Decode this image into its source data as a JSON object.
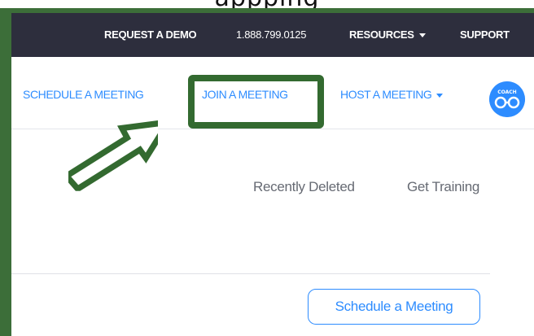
{
  "caption": {
    "text": "appping"
  },
  "topbar": {
    "request_demo": "REQUEST A DEMO",
    "phone": "1.888.799.0125",
    "resources": "RESOURCES",
    "support": "SUPPORT"
  },
  "nav": {
    "schedule": "SCHEDULE A MEETING",
    "join": "JOIN A MEETING",
    "host": "HOST A MEETING",
    "avatar_text": "COACH"
  },
  "subnav": {
    "recently_deleted": "Recently Deleted",
    "get_training": "Get Training"
  },
  "main": {
    "schedule_button": "Schedule a Meeting"
  },
  "colors": {
    "topbar_bg": "#2d2e3d",
    "link_blue": "#2d8cff",
    "highlight_green": "#336a30",
    "frame_green": "#3c6e39"
  },
  "icons": [
    "caret-down-icon",
    "avatar-glasses-icon",
    "arrow-annotation-icon"
  ]
}
